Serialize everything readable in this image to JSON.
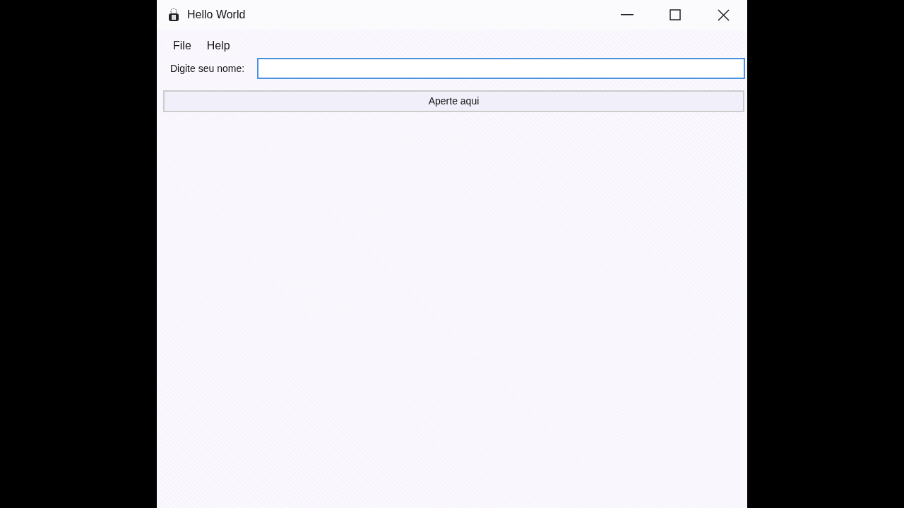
{
  "window": {
    "title": "Hello World"
  },
  "menu": [
    {
      "label": "File"
    },
    {
      "label": "Help"
    }
  ],
  "name_field": {
    "label": "Digite seu nome:",
    "focused": true
  },
  "button": {
    "label": "Aperte aqui"
  }
}
